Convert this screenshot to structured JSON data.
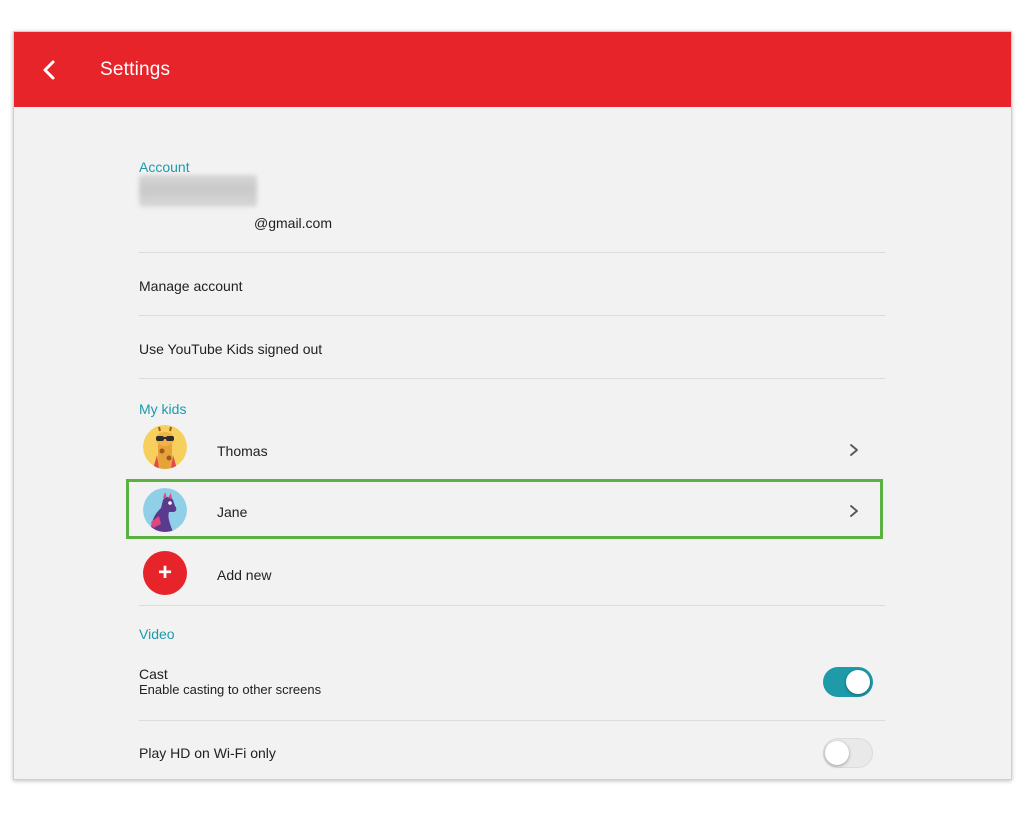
{
  "appbar": {
    "title": "Settings",
    "back_icon": "chevron-left-icon",
    "color": "#e62429"
  },
  "account": {
    "header": "Account",
    "email_suffix": "@gmail.com",
    "manage_label": "Manage account",
    "signed_out_label": "Use YouTube Kids signed out"
  },
  "my_kids": {
    "header": "My kids",
    "kids": [
      {
        "name": "Thomas",
        "avatar_icon": "giraffe-avatar-icon"
      },
      {
        "name": "Jane",
        "avatar_icon": "llama-avatar-icon"
      }
    ],
    "add_new_label": "Add new",
    "add_icon_glyph": "+",
    "chevron_icon": "chevron-right-icon"
  },
  "video": {
    "header": "Video",
    "cast_title": "Cast",
    "cast_subtitle": "Enable casting to other screens",
    "cast_enabled": true,
    "hd_label": "Play HD on Wi-Fi only",
    "hd_enabled": false
  },
  "colors": {
    "section_header": "#1a9bab",
    "toggle_on": "#1e9aa9",
    "highlight": "#5cb143"
  }
}
